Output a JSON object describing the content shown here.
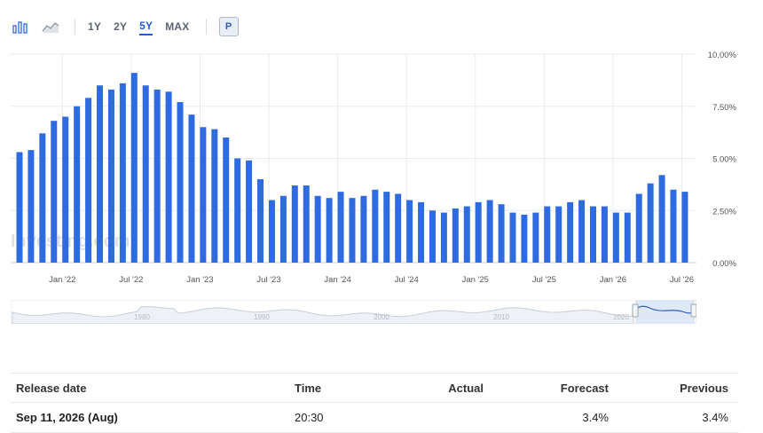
{
  "toolbar": {
    "ranges": [
      "1Y",
      "2Y",
      "5Y",
      "MAX"
    ],
    "active_range": "5Y",
    "p_label": "P",
    "icons": [
      "bar-chart-icon",
      "area-chart-icon"
    ]
  },
  "colors": {
    "bar": "#2f6be0",
    "grid": "#e8ebef",
    "axis_text": "#555555",
    "navigator_fill": "#dce6f5",
    "navigator_line": "#2f5fb8"
  },
  "watermark": "Investing.com",
  "chart_data": {
    "type": "bar",
    "x_tick_labels": [
      "Jan '22",
      "Jul '22",
      "Jan '23",
      "Jul '23",
      "Jan '24",
      "Jul '24",
      "Jan '25",
      "Jul '25",
      "Jan '26",
      "Jul '26"
    ],
    "y_tick_labels": [
      "10.00%",
      "7.50%",
      "5.00%",
      "2.50%",
      "0.00%"
    ],
    "ylim": [
      0,
      10
    ],
    "values": [
      5.3,
      5.4,
      6.2,
      6.8,
      7.0,
      7.5,
      7.9,
      8.5,
      8.3,
      8.6,
      9.1,
      8.5,
      8.3,
      8.2,
      7.7,
      7.1,
      6.5,
      6.4,
      6.0,
      5.0,
      4.9,
      4.0,
      3.0,
      3.2,
      3.7,
      3.7,
      3.2,
      3.1,
      3.4,
      3.1,
      3.2,
      3.5,
      3.4,
      3.3,
      3.0,
      2.9,
      2.5,
      2.4,
      2.6,
      2.7,
      2.9,
      3.0,
      2.8,
      2.4,
      2.3,
      2.4,
      2.7,
      2.7,
      2.9,
      3.0,
      2.7,
      2.7,
      2.4,
      2.4,
      3.3,
      3.8,
      4.2,
      3.5,
      3.4
    ],
    "navigator_labels": [
      "1980",
      "1990",
      "2000",
      "2010",
      "2020"
    ],
    "grid": true
  },
  "table": {
    "headers": {
      "release_date": "Release date",
      "time": "Time",
      "actual": "Actual",
      "forecast": "Forecast",
      "previous": "Previous"
    },
    "rows": [
      {
        "release_date": "Sep 11, 2026 (Aug)",
        "time": "20:30",
        "actual": "",
        "forecast": "3.4%",
        "previous": "3.4%"
      }
    ]
  }
}
